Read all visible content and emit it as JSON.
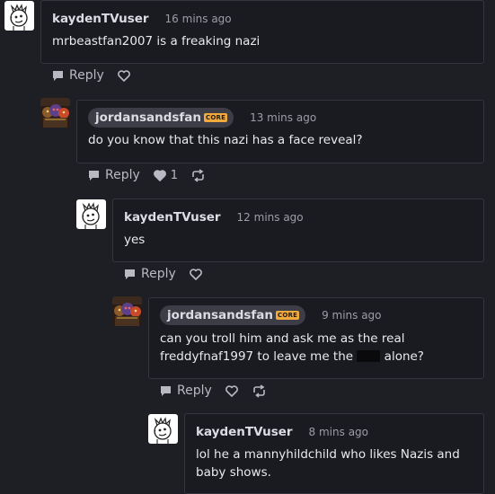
{
  "comments": [
    {
      "username": "kaydenTVuser",
      "badge": "",
      "time": "16 mins ago",
      "text": "mrbeastfan2007 is a freaking nazi",
      "reply_label": "Reply",
      "likes": "",
      "avatar_icon": "doodle-face-avatar-icon",
      "has_remix": false
    },
    {
      "username": "jordansandsfan",
      "badge": "CORE",
      "time": "13 mins ago",
      "text": "do you know that this nazi has a face reveal?",
      "reply_label": "Reply",
      "likes": "1",
      "avatar_icon": "animatronics-avatar-icon",
      "has_remix": true
    },
    {
      "username": "kaydenTVuser",
      "badge": "",
      "time": "12 mins ago",
      "text": "yes",
      "reply_label": "Reply",
      "likes": "",
      "avatar_icon": "doodle-face-avatar-icon",
      "has_remix": false
    },
    {
      "username": "jordansandsfan",
      "badge": "CORE",
      "time": "9 mins ago",
      "text_before_redaction": "can you troll him and ask me as the real freddyfnaf1997 to leave me the ",
      "text_after_redaction": " alone?",
      "reply_label": "Reply",
      "likes": "",
      "avatar_icon": "animatronics-avatar-icon",
      "has_remix": true
    },
    {
      "username": "kaydenTVuser",
      "badge": "",
      "time": "8 mins ago",
      "text": "lol he a mannyhildchild who likes Nazis and baby shows.",
      "avatar_icon": "doodle-face-avatar-icon"
    }
  ],
  "colors": {
    "background": "#1e1f25",
    "card": "#1a1b20",
    "card_border": "#34353d",
    "username_pill": "#3c3d46",
    "core_badge": "#f2a93b",
    "muted_text": "#9c9da6"
  }
}
